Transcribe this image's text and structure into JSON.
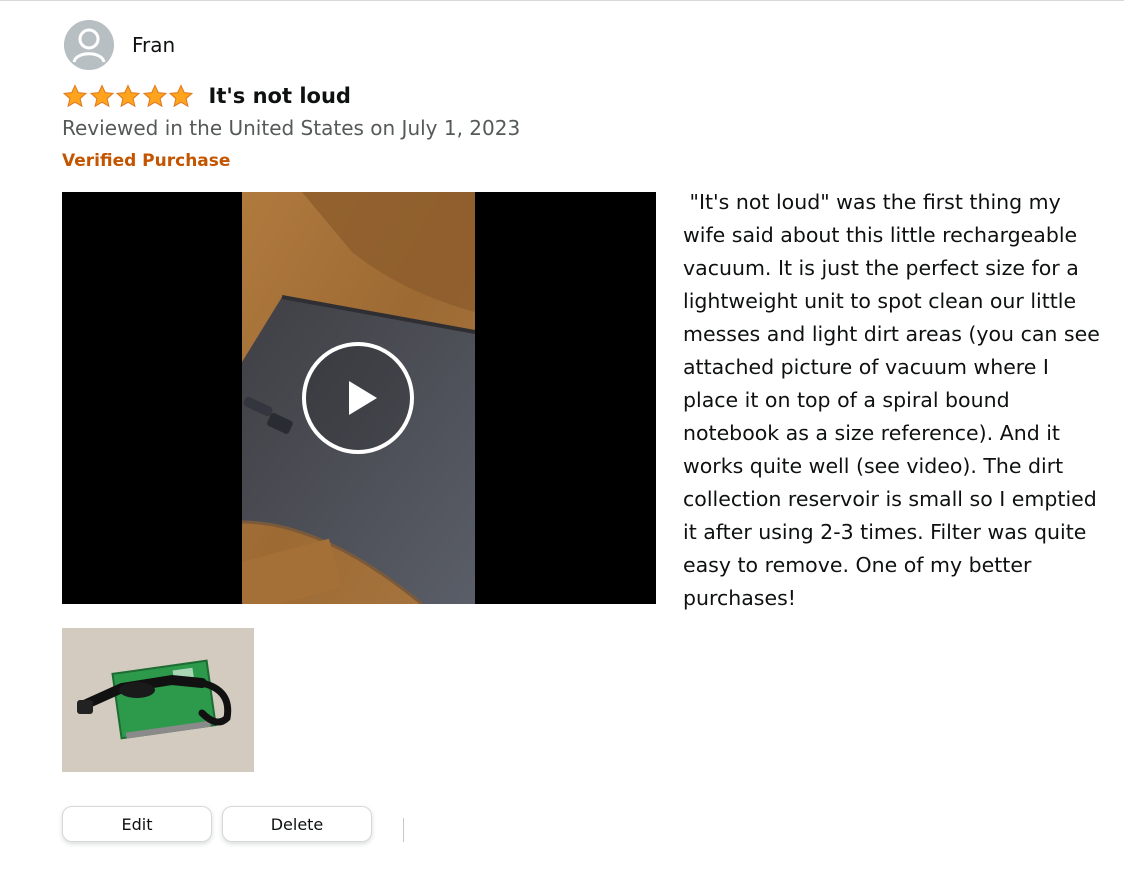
{
  "reviewer": {
    "name": "Fran",
    "avatar_icon": "user-silhouette-icon"
  },
  "review": {
    "rating": 5,
    "rating_max": 5,
    "star_color": "#ffa41c",
    "title": "It's not loud",
    "date_line": "Reviewed in the United States on July 1, 2023",
    "verified_label": "Verified Purchase",
    "verified_color": "#c45500",
    "body": " \"It's not loud\" was the first thing my wife said about this little rechargeable vacuum. It is just the perfect size for a lightweight unit to spot clean our little messes and light dirt areas (you can see attached picture of vacuum where I place it on top of a spiral bound notebook as a size reference). And it works quite well (see video). The dirt collection reservoir is small so I emptied it after using 2-3 times. Filter was quite easy to remove. One of my better purchases!"
  },
  "media": {
    "video_play_icon": "play-icon",
    "thumbnail_icon": "vacuum-photo"
  },
  "actions": {
    "edit_label": "Edit",
    "delete_label": "Delete"
  }
}
